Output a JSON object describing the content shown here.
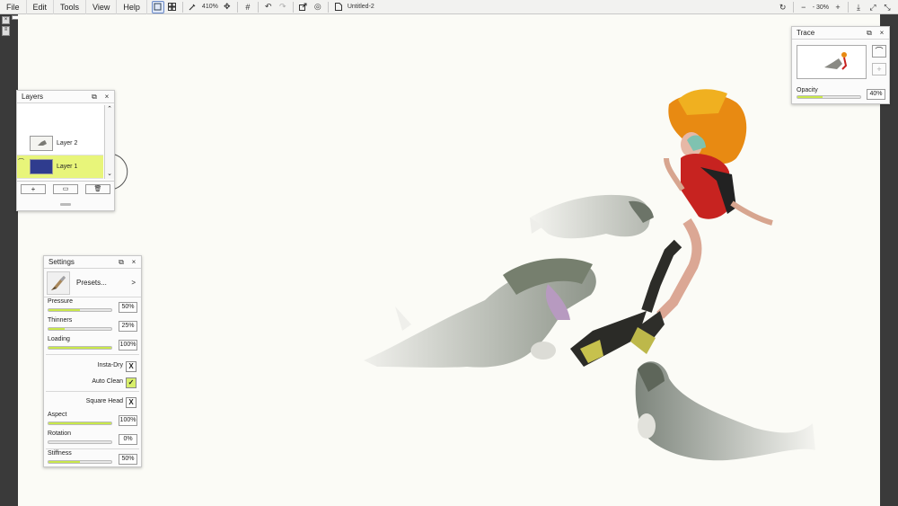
{
  "menu": [
    "File",
    "Edit",
    "Tools",
    "View",
    "Help"
  ],
  "toolbar": {
    "zoom": "410%",
    "doc_title": "Untitled-2",
    "zoom_right": "30%"
  },
  "layers": {
    "title": "Layers",
    "items": [
      {
        "name": "Layer 2",
        "selected": false
      },
      {
        "name": "Layer 1",
        "selected": true
      }
    ]
  },
  "settings": {
    "title": "Settings",
    "presets_label": "Presets...",
    "presets_arrow": ">",
    "sliders": [
      {
        "label": "Pressure",
        "value": "50%",
        "fill": 0.5
      },
      {
        "label": "Thinners",
        "value": "25%",
        "fill": 0.25
      },
      {
        "label": "Loading",
        "value": "100%",
        "fill": 1.0
      }
    ],
    "toggles": [
      {
        "label": "Insta-Dry",
        "mark": "X",
        "on": false
      },
      {
        "label": "Auto Clean",
        "mark": "✓",
        "on": true
      }
    ],
    "square_head": {
      "label": "Square Head",
      "mark": "X"
    },
    "sliders2": [
      {
        "label": "Aspect",
        "value": "100%",
        "fill": 1.0
      },
      {
        "label": "Rotation",
        "value": "0%",
        "fill": 0.0
      }
    ],
    "sliders3": [
      {
        "label": "Stiffness",
        "value": "50%",
        "fill": 0.5
      }
    ]
  },
  "trace": {
    "title": "Trace",
    "opacity_label": "Opacity",
    "opacity_value": "40%",
    "opacity_fill": 0.4
  },
  "colors": {
    "accent": "#c9e84a",
    "selected_layer": "#e8f57a",
    "canvas": "#fbfbf6"
  }
}
